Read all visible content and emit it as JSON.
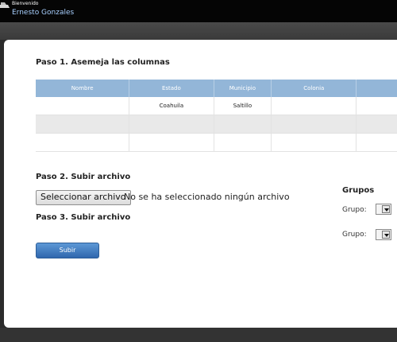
{
  "header": {
    "greeting": "Bienvenido",
    "user_name": "Ernesto Gonzales"
  },
  "step1": {
    "title": "Paso 1. Asemeja las columnas",
    "columns": [
      "Nombre",
      "Estado",
      "Municipio",
      "Colonia",
      ""
    ],
    "rows": [
      [
        "",
        "Coahuila",
        "Saltillo",
        "",
        ""
      ],
      [
        "",
        "",
        "",
        "",
        ""
      ],
      [
        "",
        "",
        "",
        "",
        ""
      ]
    ]
  },
  "step2": {
    "title": "Paso 2. Subir archivo",
    "file_button_label": "Seleccionar archivo",
    "file_status": "No se ha seleccionado ningún archivo"
  },
  "step3": {
    "title": "Paso 3. Subir archivo",
    "submit_label": "Subir"
  },
  "groups": {
    "title": "Grupos",
    "items": [
      {
        "label": "Grupo:",
        "selected": ""
      },
      {
        "label": "Grupo:",
        "selected": ""
      }
    ]
  },
  "colors": {
    "header_bg": "#050505",
    "table_header": "#93b6d8",
    "button_blue": "#2f67ad",
    "user_link": "#a8d0ff"
  }
}
